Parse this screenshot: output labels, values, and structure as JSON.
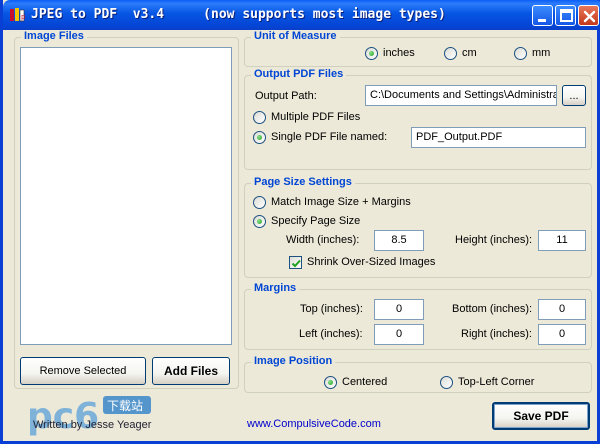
{
  "window": {
    "title": "JPEG to PDF  v3.4     (now supports most image types)"
  },
  "image_files": {
    "title": "Image Files",
    "items": [],
    "remove_button": "Remove Selected",
    "add_button": "Add Files"
  },
  "unit_of_measure": {
    "title": "Unit of Measure",
    "options": [
      "inches",
      "cm",
      "mm"
    ],
    "selected": "inches"
  },
  "output_pdf": {
    "title": "Output PDF Files",
    "path_label": "Output Path:",
    "path_value": "C:\\Documents and Settings\\Administrat",
    "browse_label": "...",
    "multiple_label": "Multiple PDF Files",
    "single_label": "Single PDF File named:",
    "single_selected": true,
    "filename": "PDF_Output.PDF"
  },
  "page_size": {
    "title": "Page Size Settings",
    "match_label": "Match Image Size + Margins",
    "specify_label": "Specify Page Size",
    "specify_selected": true,
    "width_label": "Width (inches):",
    "width_value": "8.5",
    "height_label": "Height (inches):",
    "height_value": "11",
    "shrink_label": "Shrink Over-Sized Images",
    "shrink_checked": true
  },
  "margins": {
    "title": "Margins",
    "top_label": "Top (inches):",
    "top_value": "0",
    "bottom_label": "Bottom (inches):",
    "bottom_value": "0",
    "left_label": "Left (inches):",
    "left_value": "0",
    "right_label": "Right (inches):",
    "right_value": "0"
  },
  "image_position": {
    "title": "Image Position",
    "centered_label": "Centered",
    "topleft_label": "Top-Left Corner",
    "selected": "Centered"
  },
  "footer": {
    "credit": "Written by Jesse Yeager",
    "link": "www.CompulsiveCode.com",
    "save_button": "Save PDF",
    "watermark": "pc6 下载站"
  },
  "colors": {
    "titlebar": "#0655e3",
    "group_title": "#0046d5",
    "link": "#0000cc",
    "dialog_bg": "#ece9d8"
  }
}
